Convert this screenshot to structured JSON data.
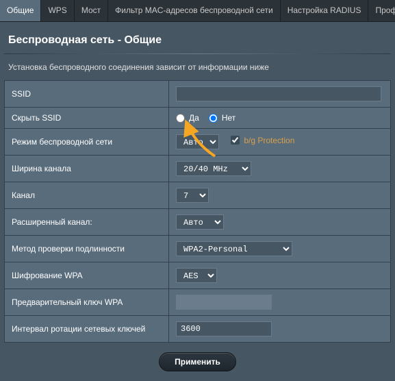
{
  "tabs": [
    {
      "label": "Общие",
      "active": true
    },
    {
      "label": "WPS",
      "active": false
    },
    {
      "label": "Мост",
      "active": false
    },
    {
      "label": "Фильтр MAC-адресов беспроводной сети",
      "active": false
    },
    {
      "label": "Настройка RADIUS",
      "active": false
    },
    {
      "label": "Профе",
      "active": false
    }
  ],
  "title": "Беспроводная сеть - Общие",
  "description": "Установка беспроводного соединения зависит от информации ниже",
  "rows": {
    "ssid": {
      "label": "SSID",
      "value": ""
    },
    "hide_ssid": {
      "label": "Скрыть SSID",
      "yes": "Да",
      "no": "Нет",
      "selected": "no"
    },
    "mode": {
      "label": "Режим беспроводной сети",
      "value": "Авто",
      "bg_label": "b/g Protection",
      "bg_checked": true
    },
    "width": {
      "label": "Ширина канала",
      "value": "20/40 MHz"
    },
    "channel": {
      "label": "Канал",
      "value": "7"
    },
    "ext_channel": {
      "label": "Расширенный канал:",
      "value": "Авто"
    },
    "auth": {
      "label": "Метод проверки подлинности",
      "value": "WPA2-Personal"
    },
    "wpa_enc": {
      "label": "Шифрование WPA",
      "value": "AES"
    },
    "psk": {
      "label": "Предварительный ключ WPA",
      "value": ""
    },
    "rekey": {
      "label": "Интервал ротации сетевых ключей",
      "value": "3600"
    }
  },
  "apply_label": "Применить"
}
